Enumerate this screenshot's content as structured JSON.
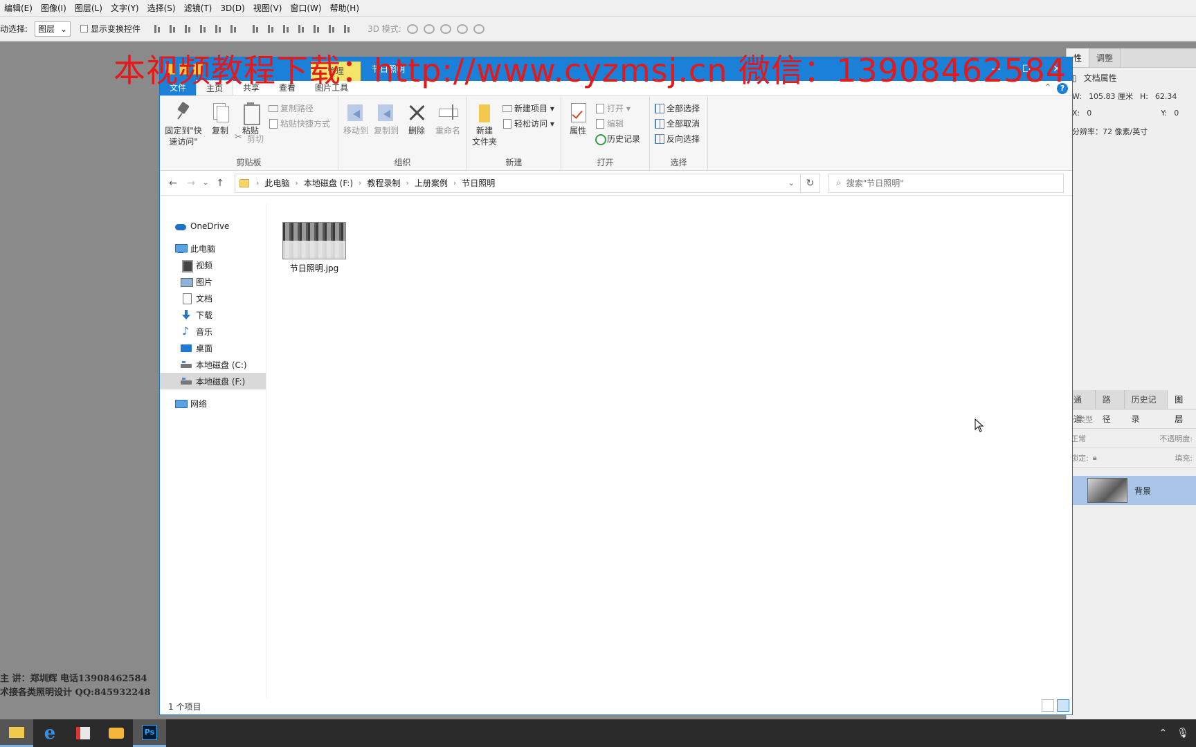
{
  "ps_menu": [
    "编辑(E)",
    "图像(I)",
    "图层(L)",
    "文字(Y)",
    "选择(S)",
    "滤镜(T)",
    "3D(D)",
    "视图(V)",
    "窗口(W)",
    "帮助(H)"
  ],
  "ps_options": {
    "auto_select_label": "动选择:",
    "auto_select_value": "图层",
    "show_transform_label": "显示变换控件",
    "mode_label": "3D 模式:"
  },
  "watermark": "本视频教程下载：http://www.cyzmsj.cn  微信：13908462584",
  "credit_lines": [
    "主 讲：郑圳辉  电话13908462584",
    "术接各类照明设计 QQ:845932248"
  ],
  "ps_right": {
    "tabs": [
      "性",
      "调整"
    ],
    "doc_props_label": "文档属性",
    "w_label": "W:",
    "w_value": "105.83 厘米",
    "h_label": "H:",
    "h_value": "62.34",
    "x_label": "X:",
    "x_value": "0",
    "y_label": "Y:",
    "y_value": "0",
    "resolution": "分辨率：72 像素/英寸",
    "layer_tabs": [
      "通道",
      "路径",
      "历史记录",
      "图层"
    ],
    "filter_kind": "类型",
    "blend_mode": "正常",
    "opacity_label": "不透明度:",
    "lock_label": "锁定:",
    "fill_label": "填充:",
    "layer_name": "背景"
  },
  "explorer": {
    "manage_tab": "管理",
    "title": "节日照明",
    "tabs": {
      "file": "文件",
      "home": "主页",
      "share": "共享",
      "view": "查看",
      "picture_tools": "图片工具"
    },
    "ribbon": {
      "clipboard": {
        "name": "剪贴板",
        "pin": "固定到\"快速访问\"",
        "copy": "复制",
        "paste": "粘贴",
        "copy_path": "复制路径",
        "paste_shortcut": "粘贴快捷方式",
        "cut": "剪切"
      },
      "organize": {
        "name": "组织",
        "move_to": "移动到",
        "copy_to": "复制到",
        "delete": "删除",
        "rename": "重命名"
      },
      "new": {
        "name": "新建",
        "new_folder": "新建\n文件夹",
        "new_item": "新建项目 ▾",
        "easy_access": "轻松访问 ▾"
      },
      "open": {
        "name": "打开",
        "properties": "属性",
        "open": "打开 ▾",
        "edit": "编辑",
        "history": "历史记录"
      },
      "select": {
        "name": "选择",
        "select_all": "全部选择",
        "select_none": "全部取消",
        "invert": "反向选择"
      }
    },
    "breadcrumbs": [
      "此电脑",
      "本地磁盘 (F:)",
      "教程录制",
      "上册案例",
      "节日照明"
    ],
    "search_placeholder": "搜索\"节日照明\"",
    "nav": {
      "onedrive": "OneDrive",
      "this_pc": "此电脑",
      "videos": "视频",
      "pictures": "图片",
      "documents": "文档",
      "downloads": "下载",
      "music": "音乐",
      "desktop": "桌面",
      "drive_c": "本地磁盘 (C:)",
      "drive_f": "本地磁盘 (F:)",
      "network": "网络"
    },
    "file_name": "节日照明.jpg",
    "status": "1 个项目"
  },
  "taskbar": {
    "ps_label": "Ps"
  }
}
